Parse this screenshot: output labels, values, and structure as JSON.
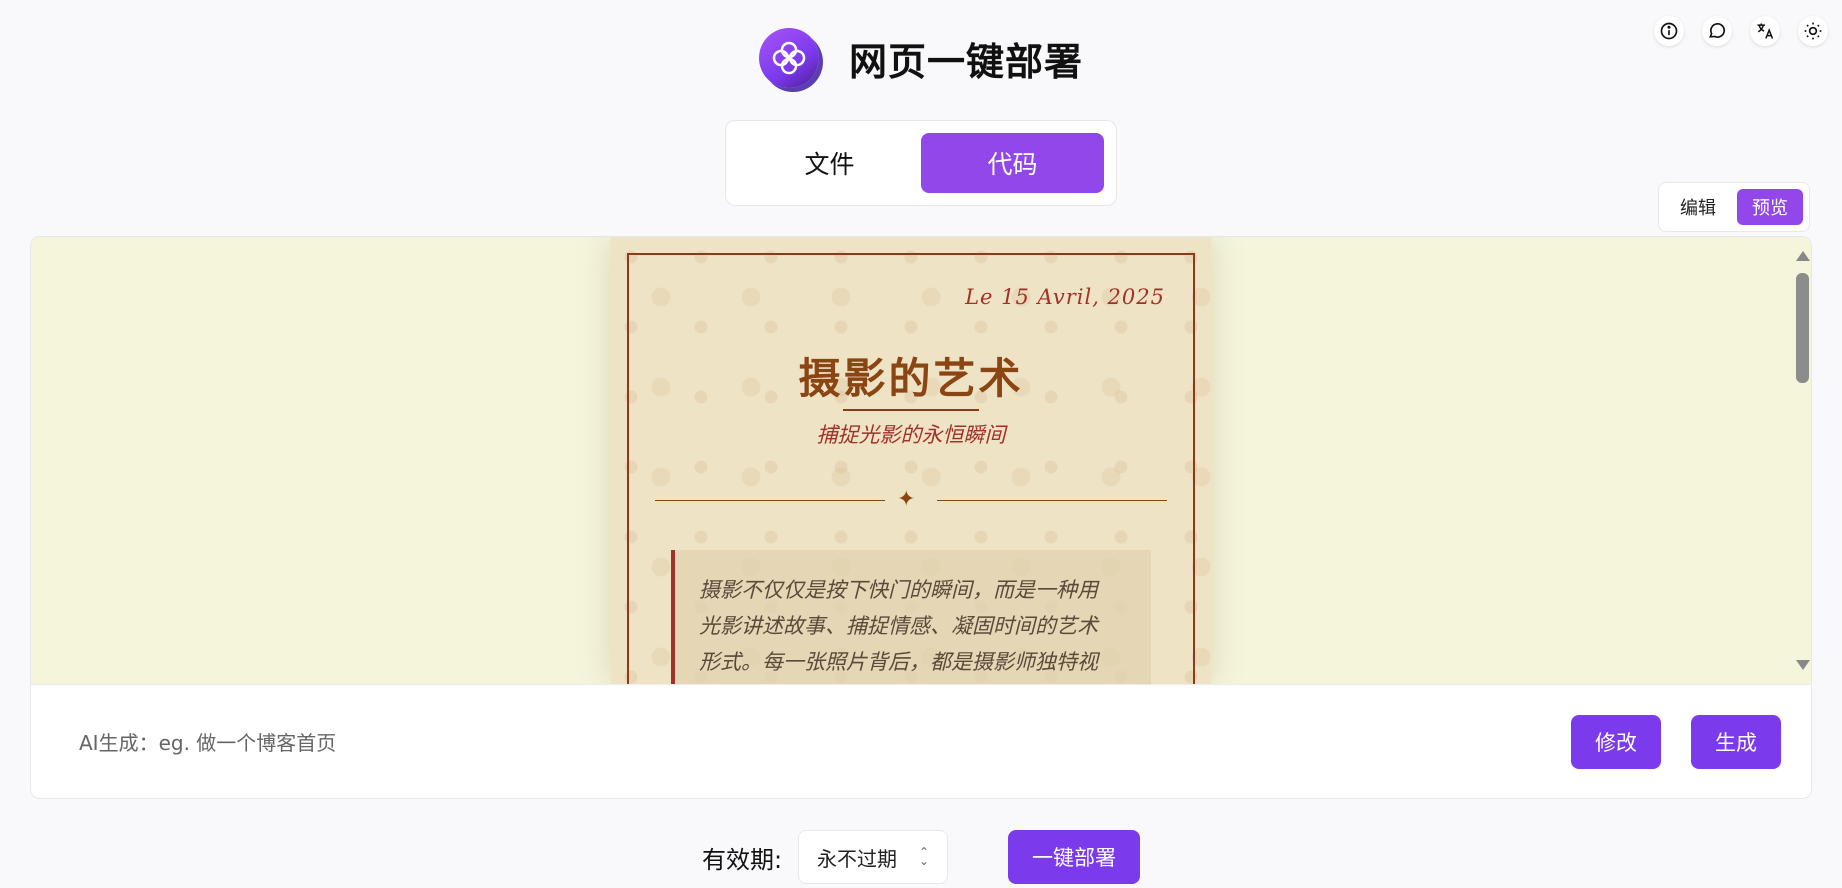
{
  "header": {
    "title": "网页一键部署",
    "logo_icon": "flower-logo-icon"
  },
  "top_icons": [
    "info-icon",
    "chat-icon",
    "translate-icon",
    "sun-icon"
  ],
  "tabs": [
    {
      "label": "文件",
      "active": false
    },
    {
      "label": "代码",
      "active": true
    }
  ],
  "mode_switch": {
    "edit_label": "编辑",
    "preview_label": "预览",
    "active": "预览"
  },
  "preview": {
    "date": "Le 15 Avril, 2025",
    "title": "摄影的艺术",
    "subtitle": "捕捉光影的永恒瞬间",
    "divider_glyph": "✦",
    "quote_lines": [
      "摄影不仅仅是按下快门的瞬间，而是一种用",
      "光影讲述故事、捕捉情感、凝固时间的艺术",
      "形式。每一张照片背后，都是摄影师独特视"
    ]
  },
  "ai": {
    "placeholder": "AI生成：eg. 做一个博客首页",
    "value": "",
    "modify_label": "修改",
    "generate_label": "生成"
  },
  "footer": {
    "expiry_label": "有效期:",
    "expiry_value": "永不过期",
    "deploy_label": "一键部署"
  },
  "colors": {
    "accent": "#7c3aed",
    "tab_active": "#9147ea",
    "preview_bg": "#f5f5dc",
    "poster_title": "#8b4513",
    "poster_accent": "#a0322a"
  }
}
